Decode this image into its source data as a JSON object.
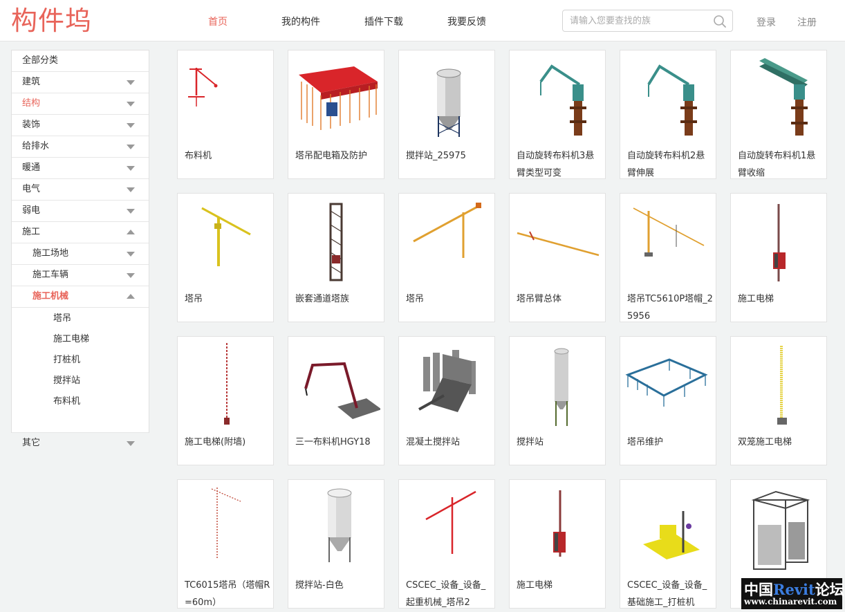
{
  "brand": {
    "logo_text": "构件坞"
  },
  "nav": {
    "items": [
      {
        "label": "首页",
        "active": true
      },
      {
        "label": "我的构件",
        "active": false
      },
      {
        "label": "插件下载",
        "active": false
      },
      {
        "label": "我要反馈",
        "active": false
      }
    ]
  },
  "search": {
    "placeholder": "请输入您要查找的族",
    "value": ""
  },
  "auth": {
    "login": "登录",
    "register": "注册"
  },
  "sidebar": {
    "all": "全部分类",
    "categories": [
      {
        "label": "建筑"
      },
      {
        "label": "结构",
        "active": true
      },
      {
        "label": "装饰"
      },
      {
        "label": "给排水"
      },
      {
        "label": "暖通"
      },
      {
        "label": "电气"
      },
      {
        "label": "弱电"
      },
      {
        "label": "施工",
        "expanded": true
      }
    ],
    "sub": [
      {
        "label": "施工场地"
      },
      {
        "label": "施工车辆"
      },
      {
        "label": "施工机械",
        "active": true,
        "expanded": true
      }
    ],
    "leaves": [
      "塔吊",
      "施工电梯",
      "打桩机",
      "搅拌站",
      "布料机"
    ],
    "other": "其它"
  },
  "cards": [
    {
      "title": "布料机",
      "icon": "boom-pump-small-red"
    },
    {
      "title": "塔吊配电箱及防护",
      "icon": "fenced-distribution-box"
    },
    {
      "title": "搅拌站_25975",
      "icon": "mixing-silo"
    },
    {
      "title": "自动旋转布料机3悬臂类型可变",
      "icon": "auto-rotating-distributor"
    },
    {
      "title": "自动旋转布料机2悬臂伸展",
      "icon": "auto-rotating-distributor"
    },
    {
      "title": "自动旋转布料机1悬臂收缩",
      "icon": "auto-rotating-distributor-folded"
    },
    {
      "title": "塔吊",
      "icon": "tower-crane-yellow"
    },
    {
      "title": "嵌套通道塔族",
      "icon": "nested-lattice-tower"
    },
    {
      "title": "塔吊",
      "icon": "tower-crane-orange"
    },
    {
      "title": "塔吊臂总体",
      "icon": "crane-jib"
    },
    {
      "title": "塔吊TC5610P塔帽_25956",
      "icon": "tower-crane-tc5610p"
    },
    {
      "title": "施工电梯",
      "icon": "construction-elevator-red"
    },
    {
      "title": "施工电梯(附墙)",
      "icon": "wall-attached-elevator"
    },
    {
      "title": "三一布料机HGY18",
      "icon": "boom-distributor-hgy18"
    },
    {
      "title": "混凝土搅拌站",
      "icon": "concrete-batching-plant"
    },
    {
      "title": "搅拌站",
      "icon": "mixing-silo-tall"
    },
    {
      "title": "塔吊维护",
      "icon": "crane-fence-enclosure"
    },
    {
      "title": "双笼施工电梯",
      "icon": "double-cage-elevator"
    },
    {
      "title": "TC6015塔吊（塔帽R=60m）",
      "icon": "tower-crane-tc6015"
    },
    {
      "title": "搅拌站-白色",
      "icon": "white-silo"
    },
    {
      "title": "CSCEC_设备_设备_起重机械_塔吊2",
      "icon": "tower-crane-red"
    },
    {
      "title": "施工电梯",
      "icon": "construction-elevator-red-tall"
    },
    {
      "title": "CSCEC_设备_设备_基础施工_打桩机",
      "icon": "pile-driver-yellow"
    },
    {
      "title": "",
      "icon": "cage-cabin"
    }
  ],
  "watermark": {
    "line1_a": "中国",
    "line1_b": "Revit",
    "line1_c": "论坛",
    "line2": "www.chinarevit.com"
  },
  "colors": {
    "accent": "#e8645a",
    "background": "#f1f3f3",
    "card": "#ffffff",
    "border": "#e2e2e2"
  }
}
